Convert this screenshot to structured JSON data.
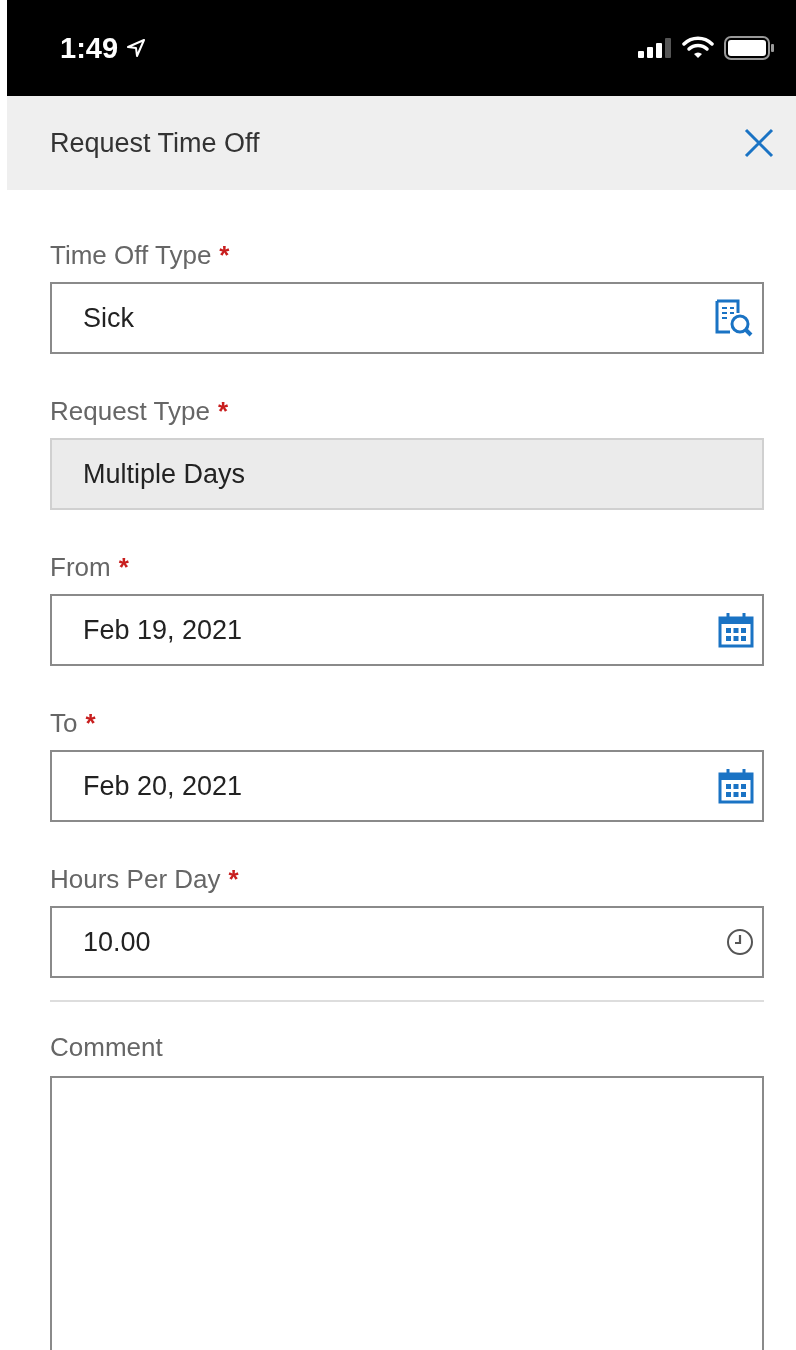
{
  "status_bar": {
    "time": "1:49"
  },
  "header": {
    "title": "Request Time Off"
  },
  "fields": [
    {
      "kind": "lookup",
      "label": "Time Off Type",
      "required_mark": "*",
      "value": "Sick"
    },
    {
      "kind": "readonly",
      "label": "Request Type",
      "required_mark": "*",
      "value": "Multiple Days"
    },
    {
      "kind": "date",
      "label": "From",
      "required_mark": "*",
      "value": "Feb 19, 2021"
    },
    {
      "kind": "date",
      "label": "To",
      "required_mark": "*",
      "value": "Feb 20, 2021"
    },
    {
      "kind": "time",
      "label": "Hours Per Day",
      "required_mark": "*",
      "value": "10.00"
    }
  ],
  "comment": {
    "label": "Comment"
  }
}
